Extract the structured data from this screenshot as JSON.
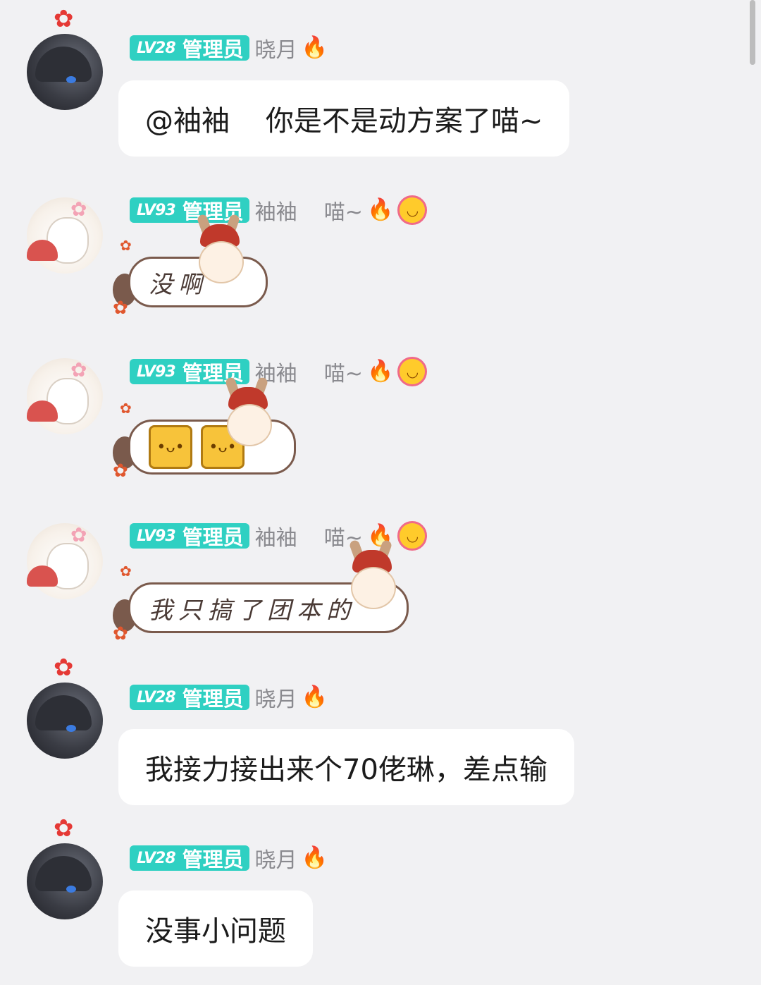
{
  "messages": [
    {
      "badge": {
        "level": "LV28",
        "role": "管理员"
      },
      "name": "晓月",
      "icons": [
        "fire-icon"
      ],
      "text": "@袖袖    你是不是动方案了喵~"
    },
    {
      "badge": {
        "level": "LV93",
        "role": "管理员"
      },
      "name": "袖袖    喵~",
      "icons": [
        "fire-icon",
        "smile-flower-icon"
      ],
      "sticker_text": "没啊"
    },
    {
      "badge": {
        "level": "LV93",
        "role": "管理员"
      },
      "name": "袖袖    喵~",
      "icons": [
        "fire-icon",
        "smile-flower-icon"
      ],
      "sticker_emojis": [
        "tofu-emoji",
        "tofu-emoji"
      ]
    },
    {
      "badge": {
        "level": "LV93",
        "role": "管理员"
      },
      "name": "袖袖    喵~",
      "icons": [
        "fire-icon",
        "smile-flower-icon"
      ],
      "sticker_text": "我只搞了团本的"
    },
    {
      "badge": {
        "level": "LV28",
        "role": "管理员"
      },
      "name": "晓月",
      "icons": [
        "fire-icon"
      ],
      "text": "我接力接出来个70佬琳，差点输"
    },
    {
      "badge": {
        "level": "LV28",
        "role": "管理员"
      },
      "name": "晓月",
      "icons": [
        "fire-icon"
      ],
      "text": "没事小问题"
    }
  ],
  "colors": {
    "background": "#f1f1f3",
    "badge": "#2fd0c2",
    "bubble": "#ffffff",
    "name_text": "#8a8a8f"
  }
}
